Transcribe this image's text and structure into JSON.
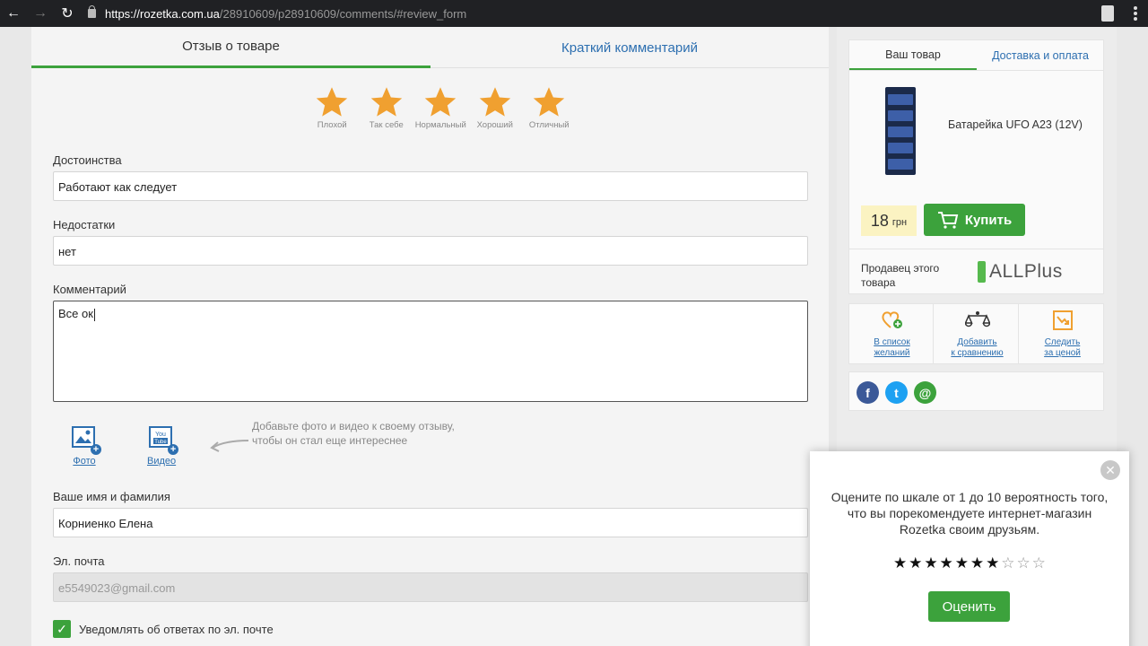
{
  "browser": {
    "url_host": "https://rozetka.com.ua",
    "url_path": "/28910609/p28910609/comments/#review_form"
  },
  "review_tabs": {
    "review": "Отзыв о товаре",
    "comment": "Краткий комментарий"
  },
  "rating": {
    "star_color": "#f0a030",
    "labels": [
      "Плохой",
      "Так себе",
      "Нормальный",
      "Хороший",
      "Отличный"
    ]
  },
  "form": {
    "advantages_label": "Достоинства",
    "advantages_value": "Работают как следует",
    "disadvantages_label": "Недостатки",
    "disadvantages_value": "нет",
    "comment_label": "Комментарий",
    "comment_value": "Все ок",
    "photo_label": "Фото",
    "video_label": "Видео",
    "media_hint": "Добавьте фото и видео к своему отзыву, чтобы он стал еще интереснее",
    "name_label": "Ваше имя и фамилия",
    "name_value": "Корниенко Елена",
    "email_label": "Эл. почта",
    "email_value": "e5549023@gmail.com",
    "notify_label": "Уведомлять об ответах по эл. почте",
    "notify_checked": true
  },
  "sidebar": {
    "tab_product": "Ваш товар",
    "tab_delivery": "Доставка и оплата",
    "product_name": "Батарейка UFO A23 (12V)",
    "price": "18",
    "currency": "грн",
    "buy_label": "Купить",
    "seller_label": "Продавец этого товара",
    "seller_name": "ALLPlus",
    "actions": [
      {
        "line1": "В список",
        "line2": "желаний",
        "icon": "heart-plus-icon"
      },
      {
        "line1": "Добавить",
        "line2": "к сравнению",
        "icon": "scales-icon"
      },
      {
        "line1": "Следить",
        "line2": "за ценой",
        "icon": "price-chart-icon"
      }
    ],
    "social": [
      {
        "icon": "facebook-icon",
        "glyph": "f",
        "color": "#3b5998"
      },
      {
        "icon": "twitter-icon",
        "glyph": "t",
        "color": "#1da1f2"
      },
      {
        "icon": "mail-icon",
        "glyph": "@",
        "color": "#3ca23c"
      }
    ]
  },
  "modal": {
    "text": "Оцените по шкале от 1 до 10 вероятность того, что вы порекомендуете интернет-магазин Rozetka своим друзьям.",
    "rating": 7,
    "max_rating": 10,
    "submit_label": "Оценить"
  }
}
